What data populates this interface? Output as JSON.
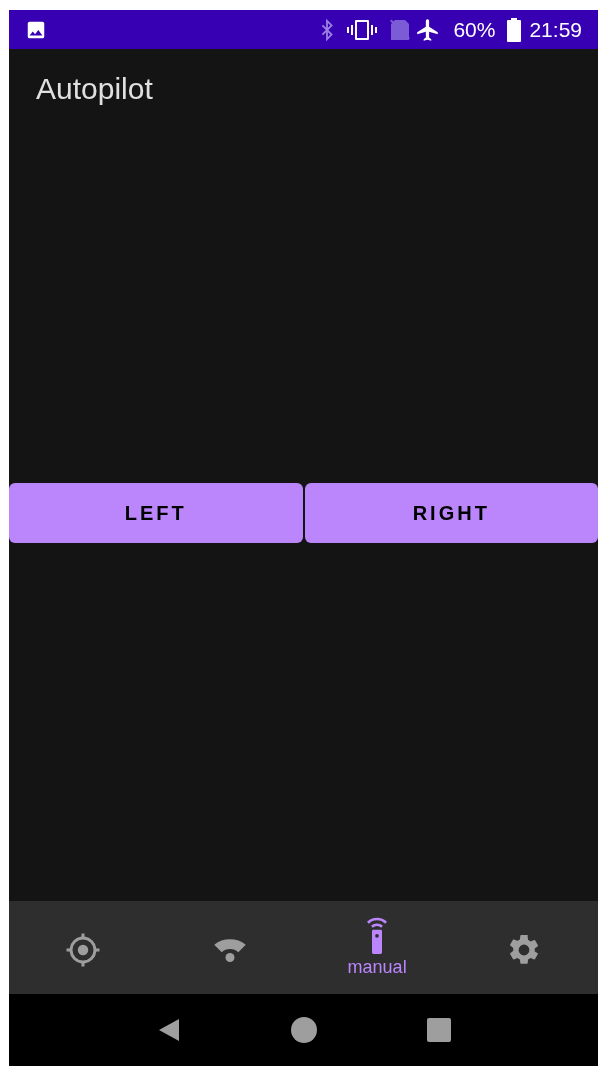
{
  "status_bar": {
    "battery": "60%",
    "time": "21:59"
  },
  "app_bar": {
    "title": "Autopilot"
  },
  "buttons": [
    {
      "label": "LEFT"
    },
    {
      "label": "RIGHT"
    }
  ],
  "bottom_nav": [
    {
      "selected": false
    },
    {
      "selected": false
    },
    {
      "label": "manual",
      "selected": true
    },
    {
      "selected": false
    }
  ]
}
